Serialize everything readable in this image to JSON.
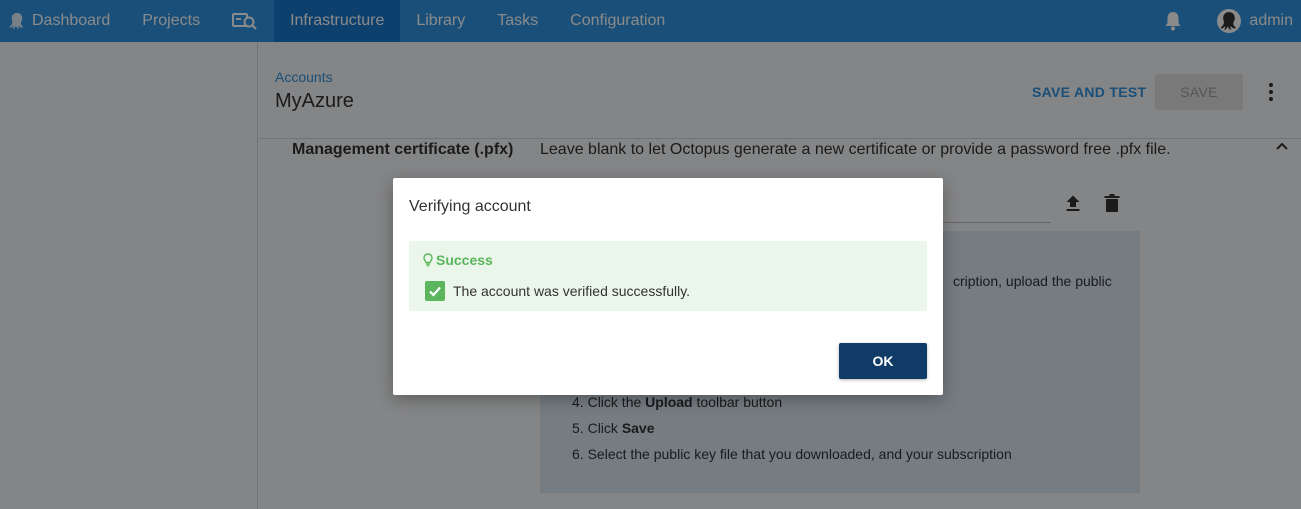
{
  "nav": {
    "items": [
      {
        "label": "Dashboard",
        "icon": "octopus-icon"
      },
      {
        "label": "Projects"
      },
      {
        "label": "",
        "icon": "machine-search-icon"
      },
      {
        "label": "Infrastructure",
        "active": true
      },
      {
        "label": "Library"
      },
      {
        "label": "Tasks"
      },
      {
        "label": "Configuration"
      }
    ],
    "user": "admin",
    "colors": {
      "bar": "#2f93e0",
      "active": "#1a77ca"
    }
  },
  "header": {
    "breadcrumb": "Accounts",
    "title": "MyAzure",
    "save_and_test": "SAVE AND TEST",
    "save": "SAVE"
  },
  "form": {
    "cert_label": "Management certificate (.pfx)",
    "cert_help": "Leave blank to let Octopus generate a new certificate or provide a password free .pfx file.",
    "instructions_partial": "cription, upload the public",
    "steps": [
      {
        "num": "4. ",
        "pre": "Click the ",
        "bold": "Upload",
        "post": " toolbar button"
      },
      {
        "num": "5. ",
        "pre": "Click ",
        "bold": "Save",
        "post": ""
      },
      {
        "num": "6. ",
        "pre": "Select the public key file that you downloaded, and your subscription",
        "bold": "",
        "post": ""
      }
    ]
  },
  "dialog": {
    "title": "Verifying account",
    "callout_title": "Success",
    "message": "The account was verified successfully.",
    "ok": "OK",
    "colors": {
      "success": "#5ab55c",
      "callout_bg": "#ebf6ea",
      "ok_bg": "#0f3b66"
    }
  }
}
